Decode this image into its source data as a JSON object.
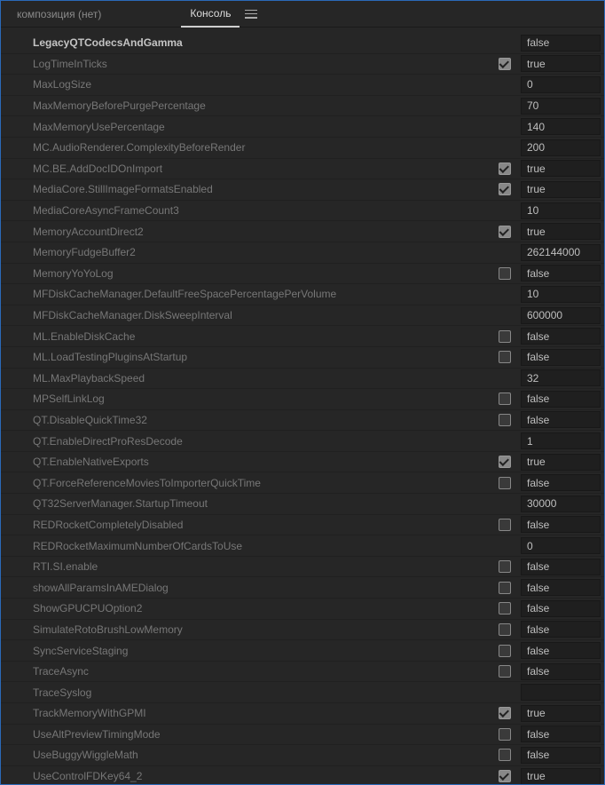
{
  "tabs": {
    "composition": "композиция (нет)",
    "console": "Консоль"
  },
  "rows": [
    {
      "name": "LegacyQTCodecsAndGamma",
      "check": null,
      "value": "false",
      "bold": true
    },
    {
      "name": "LogTimeInTicks",
      "check": true,
      "value": "true"
    },
    {
      "name": "MaxLogSize",
      "check": null,
      "value": "0"
    },
    {
      "name": "MaxMemoryBeforePurgePercentage",
      "check": null,
      "value": "70"
    },
    {
      "name": "MaxMemoryUsePercentage",
      "check": null,
      "value": "140"
    },
    {
      "name": "MC.AudioRenderer.ComplexityBeforeRender",
      "check": null,
      "value": "200"
    },
    {
      "name": "MC.BE.AddDocIDOnImport",
      "check": true,
      "value": "true"
    },
    {
      "name": "MediaCore.StillImageFormatsEnabled",
      "check": true,
      "value": "true"
    },
    {
      "name": "MediaCoreAsyncFrameCount3",
      "check": null,
      "value": "10"
    },
    {
      "name": "MemoryAccountDirect2",
      "check": true,
      "value": "true"
    },
    {
      "name": "MemoryFudgeBuffer2",
      "check": null,
      "value": "262144000"
    },
    {
      "name": "MemoryYoYoLog",
      "check": false,
      "value": "false"
    },
    {
      "name": "MFDiskCacheManager.DefaultFreeSpacePercentagePerVolume",
      "check": null,
      "value": "10"
    },
    {
      "name": "MFDiskCacheManager.DiskSweepInterval",
      "check": null,
      "value": "600000"
    },
    {
      "name": "ML.EnableDiskCache",
      "check": false,
      "value": "false"
    },
    {
      "name": "ML.LoadTestingPluginsAtStartup",
      "check": false,
      "value": "false"
    },
    {
      "name": "ML.MaxPlaybackSpeed",
      "check": null,
      "value": "32"
    },
    {
      "name": "MPSelfLinkLog",
      "check": false,
      "value": "false"
    },
    {
      "name": "QT.DisableQuickTime32",
      "check": false,
      "value": "false"
    },
    {
      "name": "QT.EnableDirectProResDecode",
      "check": null,
      "value": "1"
    },
    {
      "name": "QT.EnableNativeExports",
      "check": true,
      "value": "true"
    },
    {
      "name": "QT.ForceReferenceMoviesToImporterQuickTime",
      "check": false,
      "value": "false"
    },
    {
      "name": "QT32ServerManager.StartupTimeout",
      "check": null,
      "value": "30000"
    },
    {
      "name": "REDRocketCompletelyDisabled",
      "check": false,
      "value": "false"
    },
    {
      "name": "REDRocketMaximumNumberOfCardsToUse",
      "check": null,
      "value": "0"
    },
    {
      "name": "RTI.SI.enable",
      "check": false,
      "value": "false"
    },
    {
      "name": "showAllParamsInAMEDialog",
      "check": false,
      "value": "false"
    },
    {
      "name": "ShowGPUCPUOption2",
      "check": false,
      "value": "false"
    },
    {
      "name": "SimulateRotoBrushLowMemory",
      "check": false,
      "value": "false"
    },
    {
      "name": "SyncServiceStaging",
      "check": false,
      "value": "false"
    },
    {
      "name": "TraceAsync",
      "check": false,
      "value": "false"
    },
    {
      "name": "TraceSyslog",
      "check": null,
      "value": ""
    },
    {
      "name": "TrackMemoryWithGPMI",
      "check": true,
      "value": "true"
    },
    {
      "name": "UseAltPreviewTimingMode",
      "check": false,
      "value": "false"
    },
    {
      "name": "UseBuggyWiggleMath",
      "check": false,
      "value": "false"
    },
    {
      "name": "UseControlFDKey64_2",
      "check": true,
      "value": "true"
    }
  ]
}
